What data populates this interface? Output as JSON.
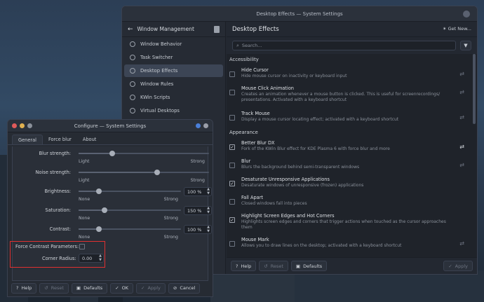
{
  "main_window": {
    "title": "Desktop Effects — System Settings",
    "sidebar": {
      "back_label": "Window Management",
      "items": [
        {
          "label": "Window Behavior"
        },
        {
          "label": "Task Switcher"
        },
        {
          "label": "Desktop Effects",
          "active": true
        },
        {
          "label": "Window Rules"
        },
        {
          "label": "KWin Scripts"
        },
        {
          "label": "Virtual Desktops"
        }
      ]
    },
    "content": {
      "title": "Desktop Effects",
      "get_new": "Get New...",
      "search_placeholder": "Search...",
      "sections": [
        {
          "title": "Accessibility",
          "effects": [
            {
              "name": "Hide Cursor",
              "desc": "Hide mouse cursor on inactivity or keyboard input",
              "checked": false,
              "configurable": true
            },
            {
              "name": "Mouse Click Animation",
              "desc": "Creates an animation whenever a mouse button is clicked. This is useful for screenrecordings/ presentations. Activated with a keyboard shortcut",
              "checked": false,
              "configurable": true
            },
            {
              "name": "Track Mouse",
              "desc": "Display a mouse cursor locating effect; activated with a keyboard shortcut",
              "checked": false,
              "configurable": true
            }
          ]
        },
        {
          "title": "Appearance",
          "effects": [
            {
              "name": "Better Blur DX",
              "desc": "Fork of the KWin Blur effect for KDE Plasma 6 with force blur and more",
              "checked": true,
              "configurable": true
            },
            {
              "name": "Blur",
              "desc": "Blurs the background behind semi-transparent windows",
              "checked": false,
              "configurable": true
            },
            {
              "name": "Desaturate Unresponsive Applications",
              "desc": "Desaturate windows of unresponsive (frozen) applications",
              "checked": true,
              "configurable": false
            },
            {
              "name": "Fall Apart",
              "desc": "Closed windows fall into pieces",
              "checked": false,
              "configurable": false
            },
            {
              "name": "Highlight Screen Edges and Hot Corners",
              "desc": "Highlights screen edges and corners that trigger actions when touched as the cursor approaches them",
              "checked": true,
              "configurable": false
            },
            {
              "name": "Mouse Mark",
              "desc": "Allows you to draw lines on the desktop; activated with a keyboard shortcut",
              "checked": false,
              "configurable": true
            }
          ]
        }
      ],
      "footer": {
        "help": "Help",
        "reset": "Reset",
        "defaults": "Defaults",
        "apply": "Apply"
      }
    }
  },
  "dialog": {
    "title": "Configure — System Settings",
    "tabs": [
      "General",
      "Force blur",
      "About"
    ],
    "rows": [
      {
        "label": "Blur strength:",
        "lo": "Light",
        "hi": "Strong",
        "value_fraction": 0.26
      },
      {
        "label": "Noise strength:",
        "lo": "Light",
        "hi": "Strong",
        "value_fraction": 0.6
      },
      {
        "label": "Brightness:",
        "lo": "None",
        "hi": "Strong",
        "value_fraction": 0.2,
        "spin": "100 %"
      },
      {
        "label": "Saturation:",
        "lo": "None",
        "hi": "Strong",
        "value_fraction": 0.25,
        "spin": "150 %"
      },
      {
        "label": "Contrast:",
        "lo": "None",
        "hi": "Strong",
        "value_fraction": 0.2,
        "spin": "100 %"
      }
    ],
    "force_contrast_label": "Force Contrast Parameters:",
    "corner_radius_label": "Corner Radius:",
    "corner_radius_value": "0.00",
    "footer": {
      "help": "Help",
      "reset": "Reset",
      "defaults": "Defaults",
      "ok": "OK",
      "apply": "Apply",
      "cancel": "Cancel"
    }
  }
}
